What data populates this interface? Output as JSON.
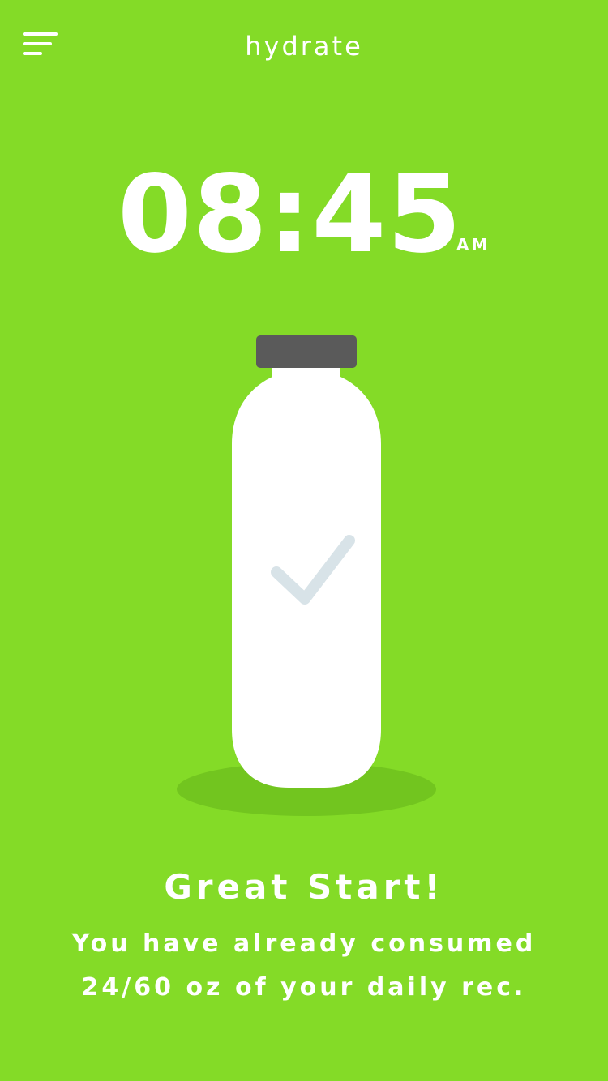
{
  "header": {
    "title": "hydrate",
    "menu_icon": "menu-icon"
  },
  "clock": {
    "time": "08:45",
    "period": "AM"
  },
  "hydration": {
    "bottle_icon": "water-bottle-icon",
    "status_icon": "checkmark-icon",
    "consumed_oz": 24,
    "goal_oz": 60
  },
  "message": {
    "headline": "Great Start!",
    "line1": "You have already consumed",
    "line2": "24/60 oz of your daily rec."
  },
  "colors": {
    "background": "#84DB27",
    "shadow": "#72C51F",
    "bottle": "#FFFFFF",
    "cap": "#5A5A5A",
    "check": "#D8E3E8",
    "text": "#FFFFFF"
  }
}
